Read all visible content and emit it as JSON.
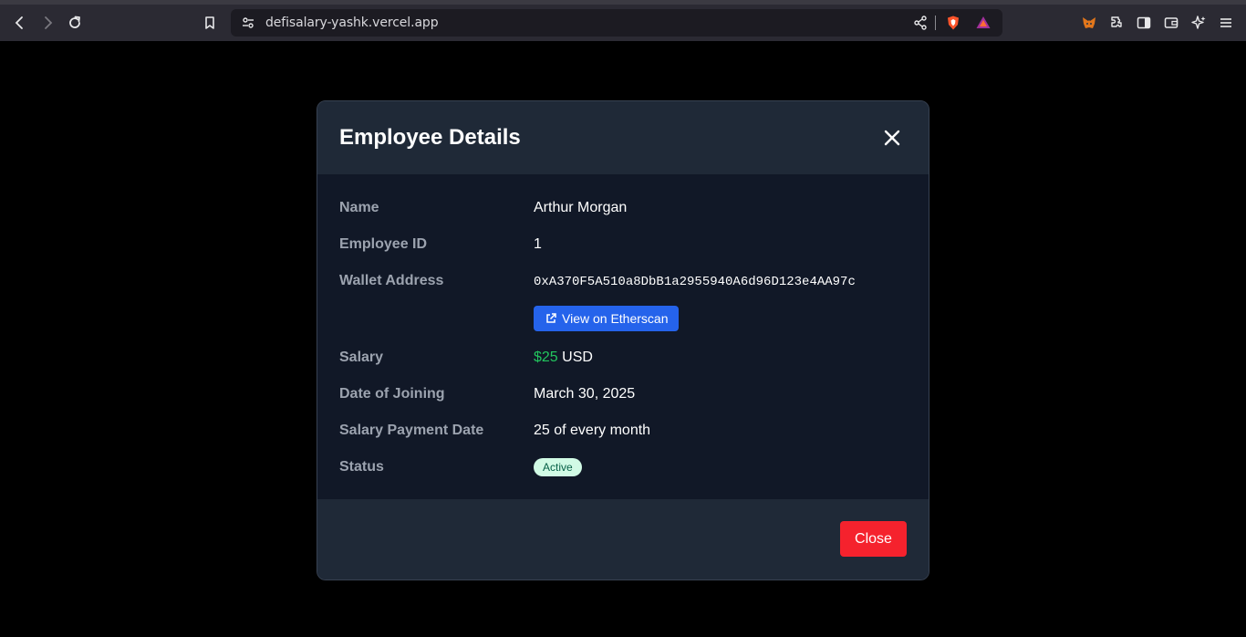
{
  "browser": {
    "url": "defisalary-yashk.vercel.app",
    "icons": [
      "back-icon",
      "forward-icon",
      "reload-icon",
      "bookmark-icon",
      "site-settings-icon",
      "share-icon",
      "brave-shield-icon",
      "brave-rewards-icon",
      "metamask-icon",
      "extensions-icon",
      "sidebar-icon",
      "wallet-icon",
      "leo-ai-icon",
      "menu-icon"
    ]
  },
  "modal": {
    "title": "Employee Details",
    "fields": {
      "name_label": "Name",
      "name_value": "Arthur Morgan",
      "id_label": "Employee ID",
      "id_value": "1",
      "wallet_label": "Wallet Address",
      "wallet_value": "0xA370F5A510a8DbB1a2955940A6d96D123e4AA97c",
      "etherscan_label": "View on Etherscan",
      "salary_label": "Salary",
      "salary_amount": "$25",
      "salary_currency": "USD",
      "joining_label": "Date of Joining",
      "joining_value": "March 30, 2025",
      "payment_label": "Salary Payment Date",
      "payment_value": "25 of every month",
      "status_label": "Status",
      "status_value": "Active"
    },
    "close_label": "Close"
  },
  "colors": {
    "header_bg": "#1f2937",
    "body_bg": "#111827",
    "accent_blue": "#2563eb",
    "close_red": "#f5222d",
    "salary_green": "#22c55e",
    "badge_bg": "#d1fae5"
  }
}
